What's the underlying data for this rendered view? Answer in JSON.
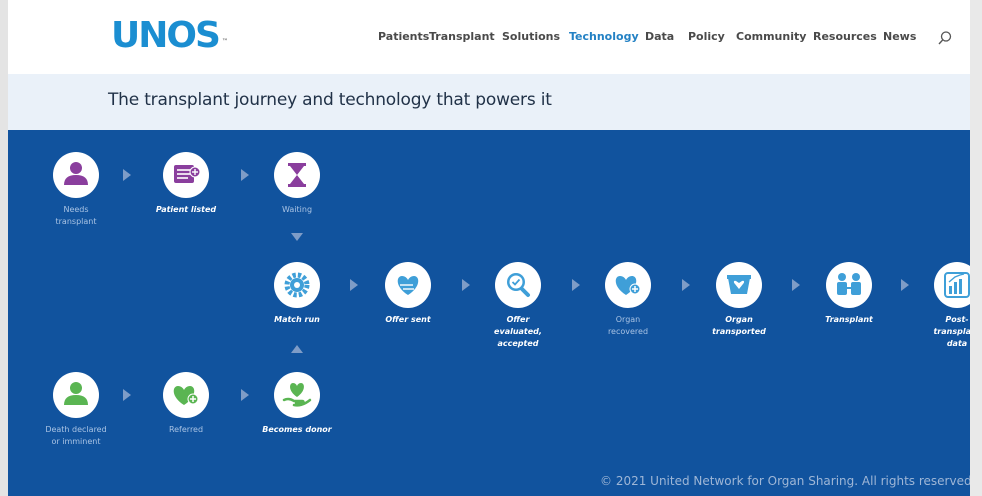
{
  "header": {
    "logo_text": "UNOS",
    "logo_mark": "™",
    "nav": [
      "Patients",
      "Transplant",
      "Solutions",
      "Technology",
      "Data",
      "Policy",
      "Community",
      "Resources",
      "News"
    ],
    "active_nav": "Technology",
    "search_icon": "search-icon"
  },
  "page_title": "The transplant journey and technology that powers it",
  "steps": {
    "needs_transplant": "Needs\ntransplant",
    "patient_listed": "Patient listed",
    "waiting": "Waiting",
    "match_run": "Match run",
    "offer_sent": "Offer sent",
    "offer_evaluated": "Offer\nevaluated,\naccepted",
    "organ_recovered": "Organ\nrecovered",
    "organ_transported": "Organ\ntransported",
    "transplant": "Transplant",
    "post_transplant": "Post-\ntransplant\ndata",
    "death_declared": "Death declared\nor imminent",
    "referred": "Referred",
    "becomes_donor": "Becomes donor"
  },
  "footer": "© 2021 United Network for Organ Sharing. All rights reserved.",
  "colors": {
    "brand": "#1b8ed1",
    "active_nav": "#2381c4",
    "panel": "#11539e",
    "purple": "#8a3e9d",
    "light_blue": "#3f9fd8",
    "green": "#5ab552"
  }
}
